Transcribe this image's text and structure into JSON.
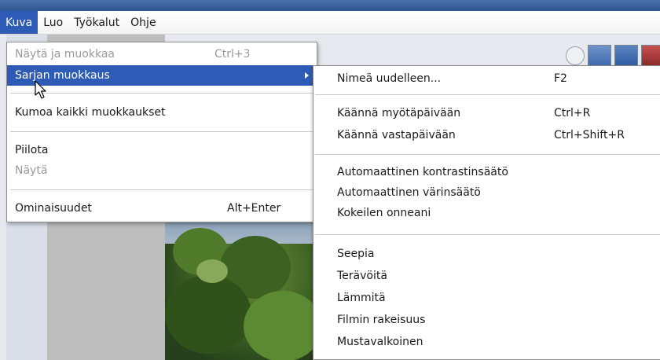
{
  "menubar": {
    "items": [
      {
        "label": "Kuva"
      },
      {
        "label": "Luo"
      },
      {
        "label": "Työkalut"
      },
      {
        "label": "Ohje"
      }
    ]
  },
  "menu": {
    "items": [
      {
        "label": "Näytä ja muokkaa",
        "shortcut": "Ctrl+3"
      },
      {
        "label": "Sarjan muokkaus"
      },
      {
        "label": "Kumoa kaikki muokkaukset"
      },
      {
        "label": "Piilota"
      },
      {
        "label": "Näytä"
      },
      {
        "label": "Ominaisuudet",
        "shortcut": "Alt+Enter"
      }
    ]
  },
  "submenu": {
    "items": [
      {
        "label": "Nimeä uudelleen...",
        "shortcut": "F2"
      },
      {
        "label": "Käännä myötäpäivään",
        "shortcut": "Ctrl+R"
      },
      {
        "label": "Käännä vastapäivään",
        "shortcut": "Ctrl+Shift+R"
      },
      {
        "label": "Automaattinen kontrastinsäätö"
      },
      {
        "label": "Automaattinen värinsäätö"
      },
      {
        "label": "Kokeilen onneani"
      },
      {
        "label": "Seepia"
      },
      {
        "label": "Terävöitä"
      },
      {
        "label": "Lämmitä"
      },
      {
        "label": "Filmin rakeisuus"
      },
      {
        "label": "Mustavalkoinen"
      }
    ]
  },
  "colors": {
    "highlight": "#2d5bb5",
    "disabled_text": "#9a9a9a"
  }
}
